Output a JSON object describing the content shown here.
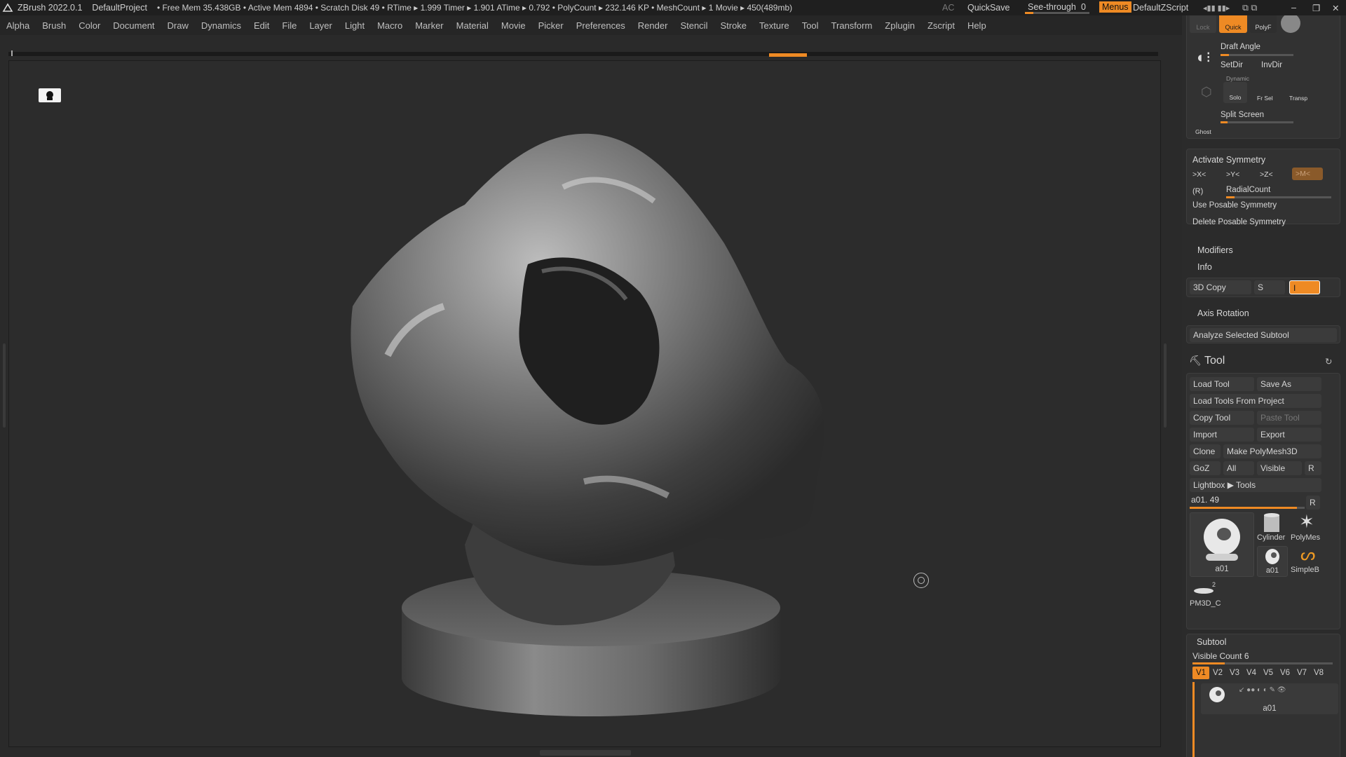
{
  "titlebar": {
    "app": "ZBrush 2022.0.1",
    "project": "DefaultProject",
    "stats": "• Free Mem 35.438GB • Active Mem 4894 • Scratch Disk 49 •  RTime ▸ 1.999 Timer ▸ 1.901 ATime ▸ 0.792 • PolyCount ▸ 232.146 KP  • MeshCount ▸ 1  Movie ▸ 450(489mb)",
    "ac": "AC",
    "quicksave": "QuickSave",
    "seethrough": "See-through",
    "seethrough_value": "0",
    "menus": "Menus",
    "script": "DefaultZScript"
  },
  "menubar": [
    "Alpha",
    "Brush",
    "Color",
    "Document",
    "Draw",
    "Dynamics",
    "Edit",
    "File",
    "Layer",
    "Light",
    "Macro",
    "Marker",
    "Material",
    "Movie",
    "Picker",
    "Preferences",
    "Render",
    "Stencil",
    "Stroke",
    "Texture",
    "Tool",
    "Transform",
    "Zplugin",
    "Zscript",
    "Help"
  ],
  "draw_panel": {
    "lock": "Lock",
    "quick": "Quick",
    "polyf": "PolyF",
    "draft_angle": "Draft Angle",
    "setdir": "SetDir",
    "invdir": "InvDir",
    "dynamic": "Dynamic",
    "solo": "Solo",
    "frsel": "Fr Sel",
    "transp": "Transp",
    "split_screen": "Split Screen",
    "ghost": "Ghost"
  },
  "symmetry": {
    "title": "Activate Symmetry",
    "x": ">X<",
    "y": ">Y<",
    "z": ">Z<",
    "m": ">M<",
    "r": "(R)",
    "radial": "RadialCount",
    "use_posable": "Use Posable Symmetry",
    "delete_posable": "Delete Posable Symmetry"
  },
  "modifiers": "Modifiers",
  "info": "Info",
  "copy3d": {
    "label": "3D Copy",
    "s": "S",
    "i": "I"
  },
  "axis_rotation": "Axis Rotation",
  "analyze": "Analyze Selected Subtool",
  "tool": {
    "title": "Tool",
    "load": "Load Tool",
    "saveas": "Save As",
    "load_project": "Load Tools From Project",
    "copy": "Copy Tool",
    "paste": "Paste Tool",
    "import": "Import",
    "export": "Export",
    "clone": "Clone",
    "make_polymesh": "Make PolyMesh3D",
    "goz": "GoZ",
    "all": "All",
    "visible": "Visible",
    "r": "R",
    "lightbox": "Lightbox ▶ Tools",
    "current": "a01. 49",
    "current_level": 0.93,
    "thumbs": [
      {
        "name": "a01"
      },
      {
        "name": "Cylinder"
      },
      {
        "name": "PolyMes"
      },
      {
        "name": "a01"
      },
      {
        "name": "SimpleB"
      },
      {
        "name": "PM3D_C"
      }
    ],
    "pm3d_count": "2"
  },
  "subtool": {
    "title": "Subtool",
    "visible_count": "Visible Count 6",
    "versions": [
      "V1",
      "V2",
      "V3",
      "V4",
      "V5",
      "V6",
      "V7",
      "V8"
    ],
    "item": "a01"
  }
}
